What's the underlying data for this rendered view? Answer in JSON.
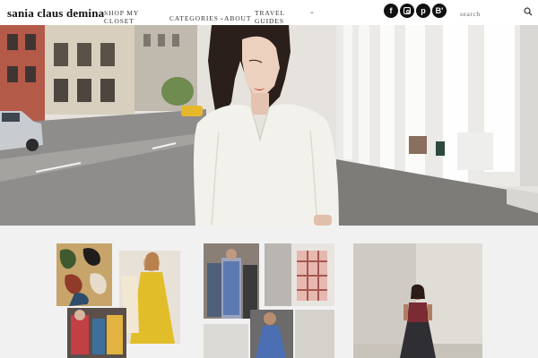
{
  "site": {
    "logo": "sania claus demina"
  },
  "nav": {
    "shop": "SHOP MY CLOSET",
    "categories": "CATEGORIES",
    "about": "ABOUT",
    "travel": "TRAVEL GUIDES",
    "caret": "⌄"
  },
  "social": {
    "facebook": "f",
    "pinterest": "p",
    "bloglovin": "B'"
  },
  "search": {
    "placeholder": "search"
  },
  "hero": {
    "slides": 5,
    "active_slide": 1
  },
  "colors": {
    "header_bg": "#ffffff",
    "page_bg": "#f1f1f1",
    "social_bg": "#111111",
    "text": "#111111"
  },
  "icons": [
    "facebook-icon",
    "instagram-icon",
    "pinterest-icon",
    "bloglovin-icon",
    "search-icon",
    "chevron-down-icon"
  ]
}
